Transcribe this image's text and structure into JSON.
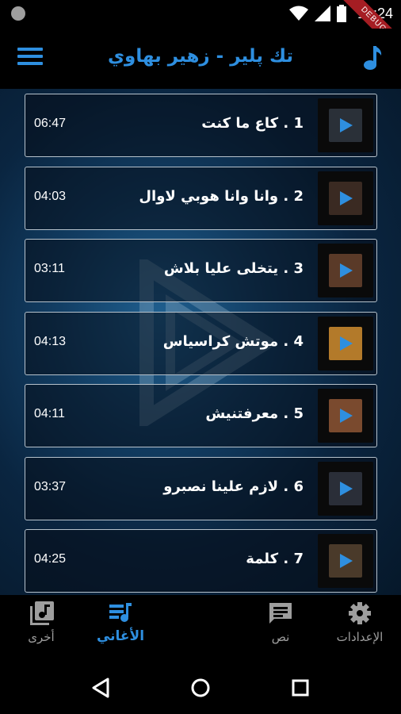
{
  "status_bar": {
    "time": "10:24",
    "ribbon": "DEBUG"
  },
  "app_bar": {
    "title": "تك پلير - زهير بهاوي"
  },
  "songs": [
    {
      "title": "1 . كاع ما كنت",
      "duration": "06:47",
      "thumb_color": "#2a3038"
    },
    {
      "title": "2 . وانا وانا هوبي لاوال",
      "duration": "04:03",
      "thumb_color": "#3a2a22"
    },
    {
      "title": "3 . يتخلى عليا بلاش",
      "duration": "03:11",
      "thumb_color": "#5a3a28"
    },
    {
      "title": "4 . موتش كراسياس",
      "duration": "04:13",
      "thumb_color": "#b37a2a"
    },
    {
      "title": "5 .  معرفتنيش",
      "duration": "04:11",
      "thumb_color": "#7a4a2e"
    },
    {
      "title": "6 . لازم علينا نصبرو",
      "duration": "03:37",
      "thumb_color": "#2a2e38"
    },
    {
      "title": "7 . كلمة",
      "duration": "04:25",
      "thumb_color": "#4a3a2a"
    }
  ],
  "bottom_nav": {
    "other_label": "أخرى",
    "songs_label": "الأغاني",
    "text_label": "نص",
    "settings_label": "الإعدادات"
  },
  "colors": {
    "accent": "#2e8fe0",
    "play_icon": "#2e8fe0"
  }
}
